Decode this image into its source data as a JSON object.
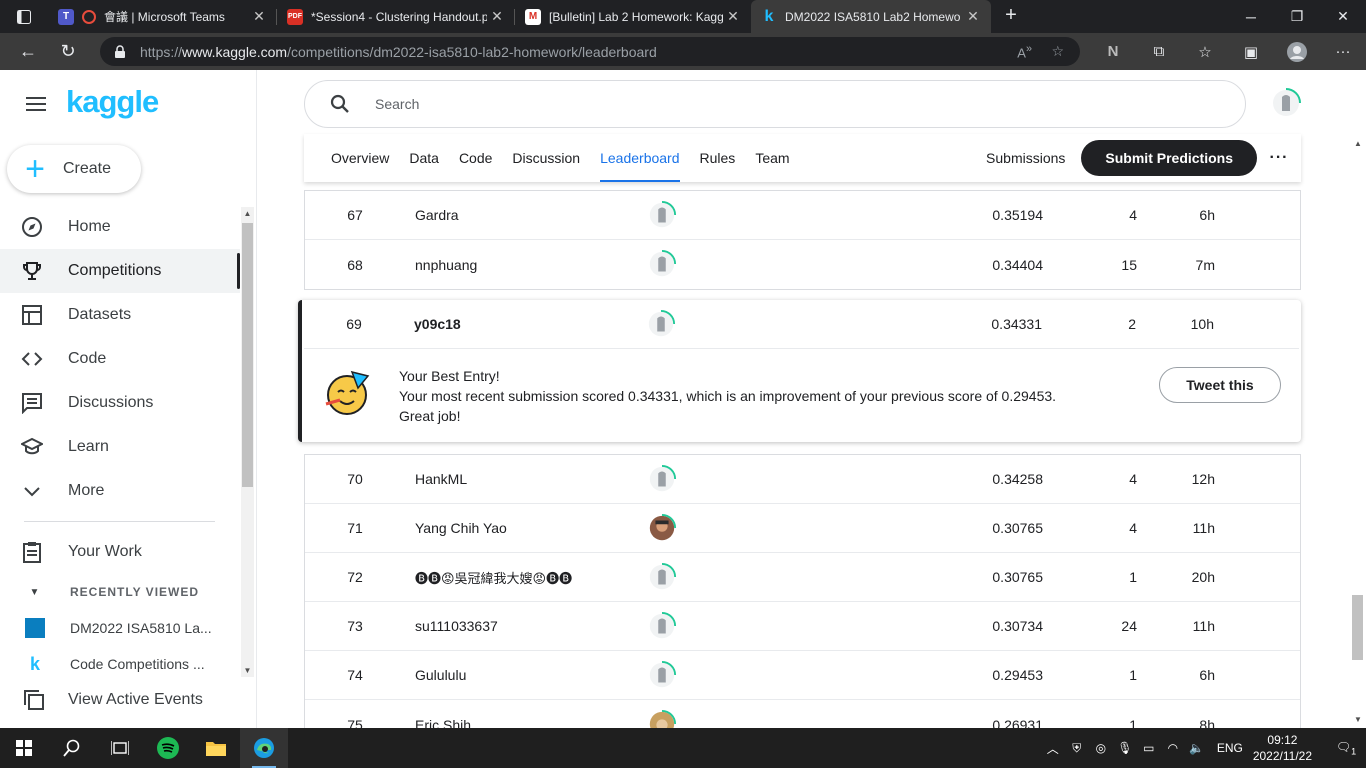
{
  "browser": {
    "tabs": [
      {
        "title": "會議 | Microsoft Teams",
        "active": false
      },
      {
        "title": "*Session4 - Clustering Handout.p",
        "active": false
      },
      {
        "title": "[Bulletin] Lab 2 Homework: Kagg",
        "active": false
      },
      {
        "title": "DM2022 ISA5810 Lab2 Homewo",
        "active": true
      }
    ],
    "url_prefix": "https://",
    "url_host": "www.kaggle.com",
    "url_path": "/competitions/dm2022-isa5810-lab2-homework/leaderboard"
  },
  "sidebar": {
    "logo": "kaggle",
    "create_label": "Create",
    "items": [
      {
        "label": "Home",
        "icon": "compass-icon"
      },
      {
        "label": "Competitions",
        "icon": "trophy-icon"
      },
      {
        "label": "Datasets",
        "icon": "table-icon"
      },
      {
        "label": "Code",
        "icon": "code-icon"
      },
      {
        "label": "Discussions",
        "icon": "comment-icon"
      },
      {
        "label": "Learn",
        "icon": "school-icon"
      },
      {
        "label": "More",
        "icon": "chevron-down-icon"
      }
    ],
    "your_work": "Your Work",
    "recently_viewed": "RECENTLY VIEWED",
    "recent": [
      "DM2022 ISA5810 La...",
      "Code Competitions ..."
    ],
    "view_active_events": "View Active Events"
  },
  "search": {
    "placeholder": "Search"
  },
  "comp_tabs": [
    "Overview",
    "Data",
    "Code",
    "Discussion",
    "Leaderboard",
    "Rules",
    "Team"
  ],
  "comp_active_tab": "Leaderboard",
  "submissions_label": "Submissions",
  "submit_label": "Submit Predictions",
  "rows_top": [
    {
      "rank": "67",
      "team": "Gardra",
      "score": "0.35194",
      "entries": "4",
      "last": "6h"
    },
    {
      "rank": "68",
      "team": "nnphuang",
      "score": "0.34404",
      "entries": "15",
      "last": "7m"
    }
  ],
  "best": {
    "rank": "69",
    "team": "y09c18",
    "score": "0.34331",
    "entries": "2",
    "last": "10h",
    "headline": "Your Best Entry!",
    "message": "Your most recent submission scored 0.34331, which is an improvement of your previous score of 0.29453. Great job!",
    "tweet": "Tweet this"
  },
  "rows_bottom": [
    {
      "rank": "70",
      "team": "HankML",
      "score": "0.34258",
      "entries": "4",
      "last": "12h"
    },
    {
      "rank": "71",
      "team": "Yang Chih Yao",
      "score": "0.30765",
      "entries": "4",
      "last": "11h"
    },
    {
      "rank": "72",
      "team": "🅑🅑😡吳冠緯我大嫂😡🅑🅑",
      "score": "0.30765",
      "entries": "1",
      "last": "20h"
    },
    {
      "rank": "73",
      "team": "su111033637",
      "score": "0.30734",
      "entries": "24",
      "last": "11h"
    },
    {
      "rank": "74",
      "team": "Gulululu",
      "score": "0.29453",
      "entries": "1",
      "last": "6h"
    },
    {
      "rank": "75",
      "team": "Eric Shih",
      "score": "0.26931",
      "entries": "1",
      "last": "8h"
    }
  ],
  "taskbar": {
    "lang": "ENG",
    "time": "09:12",
    "date": "2022/11/22",
    "notif_count": "1"
  },
  "colors": {
    "kaggle_blue": "#20beff",
    "active_tab": "#1a73e8",
    "dark": "#202124"
  }
}
